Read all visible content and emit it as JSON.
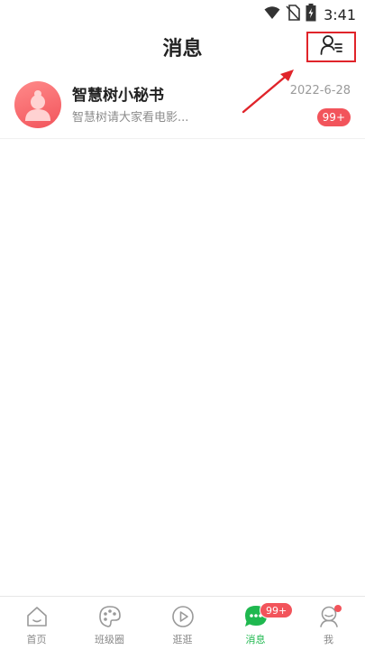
{
  "status_bar": {
    "time": "3:41",
    "icons": [
      "wifi-icon",
      "no-sim-icon",
      "battery-charging-icon"
    ]
  },
  "header": {
    "title": "消息",
    "contacts_icon": "contacts-icon"
  },
  "chats": [
    {
      "name": "智慧树小秘书",
      "preview": "智慧树请大家看电影...",
      "date": "2022-6-28",
      "unread": "99+"
    }
  ],
  "tabs": [
    {
      "label": "首页",
      "icon": "home-icon",
      "active": false
    },
    {
      "label": "班级圈",
      "icon": "palette-icon",
      "active": false
    },
    {
      "label": "逛逛",
      "icon": "play-icon",
      "active": false
    },
    {
      "label": "消息",
      "icon": "chat-icon",
      "active": true,
      "badge": "99+"
    },
    {
      "label": "我",
      "icon": "profile-icon",
      "active": false,
      "dot": true
    }
  ],
  "colors": {
    "accent_green": "#1fb84f",
    "badge_red": "#f2545b",
    "highlight_red": "#e0242a"
  }
}
